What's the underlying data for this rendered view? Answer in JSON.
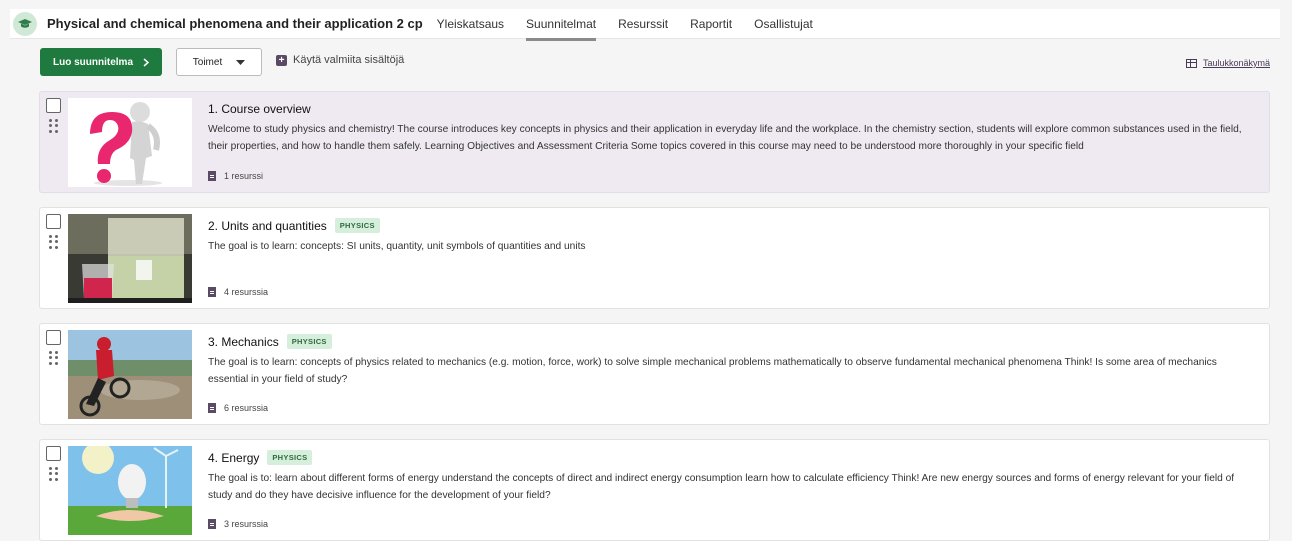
{
  "header": {
    "course_title": "Physical and chemical phenomena and their application 2 cp",
    "tabs": [
      {
        "label": "Yleiskatsaus",
        "active": false
      },
      {
        "label": "Suunnitelmat",
        "active": true
      },
      {
        "label": "Resurssit",
        "active": false
      },
      {
        "label": "Raportit",
        "active": false
      },
      {
        "label": "Osallistujat",
        "active": false
      }
    ]
  },
  "toolbar": {
    "create_label": "Luo suunnitelma",
    "actions_label": "Toimet",
    "ready_content_label": "Käytä valmiita sisältöjä",
    "table_view_label": "Taulukkonäkymä"
  },
  "plans": [
    {
      "title": "1. Course overview",
      "badge": "",
      "description": "Welcome to study physics and chemistry! The course introduces key concepts in physics and their application in everyday life and the workplace. In the chemistry section, students will explore common substances used in the field, their properties, and how to handle them safely. Learning Objectives and Assessment Criteria Some topics covered in this course may need to be understood more thoroughly in your specific field",
      "resources": "1 resurssi",
      "image": "question-mark-figure"
    },
    {
      "title": "2. Units and quantities",
      "badge": "PHYSICS",
      "description": "The goal is to learn: concepts: SI units, quantity, unit symbols of quantities and units",
      "resources": "4 resurssia",
      "image": "lab-beakers"
    },
    {
      "title": "3. Mechanics",
      "badge": "PHYSICS",
      "description": "The goal is to learn: concepts of physics related to mechanics (e.g. motion, force, work) to solve simple mechanical problems mathematically to observe fundamental mechanical phenomena Think! Is some area of mechanics essential in your field of study?",
      "resources": "6 resurssia",
      "image": "motocross-rider"
    },
    {
      "title": "4. Energy",
      "badge": "PHYSICS",
      "description": "The goal is to: learn about different forms of energy understand the concepts of direct and indirect energy consumption learn how to calculate efficiency Think! Are new energy sources and forms of energy relevant for your field of study and do they have decisive influence for the development of your field?",
      "resources": "3 resurssia",
      "image": "energy-bulb"
    }
  ],
  "colors": {
    "primary_green": "#1e7a3e",
    "highlight_row": "#efeaf1",
    "badge_bg": "#d6eedc",
    "accent_purple": "#5a4a66"
  }
}
